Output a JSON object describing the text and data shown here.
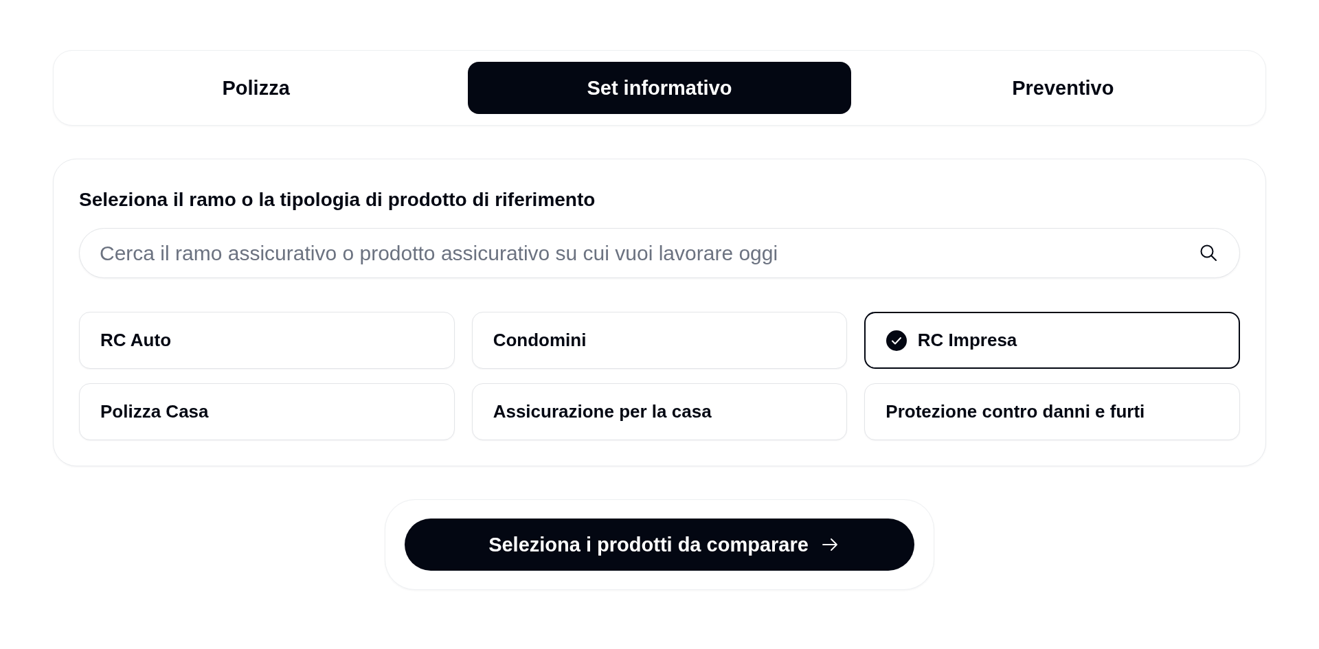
{
  "tabs": [
    {
      "label": "Polizza",
      "selected": false
    },
    {
      "label": "Set informativo",
      "selected": true
    },
    {
      "label": "Preventivo",
      "selected": false
    }
  ],
  "product_picker": {
    "heading": "Seleziona il ramo o la tipologia di prodotto di riferimento",
    "search": {
      "placeholder": "Cerca il ramo assicurativo o prodotto assicurativo su cui vuoi lavorare oggi"
    },
    "options": [
      {
        "label": "RC Auto",
        "selected": false
      },
      {
        "label": "Condomini",
        "selected": false
      },
      {
        "label": "RC Impresa",
        "selected": true
      },
      {
        "label": "Polizza Casa",
        "selected": false
      },
      {
        "label": "Assicurazione per la casa",
        "selected": false
      },
      {
        "label": "Protezione contro danni e furti",
        "selected": false
      }
    ]
  },
  "primary_action": {
    "label": "Seleziona i prodotti da comparare"
  }
}
